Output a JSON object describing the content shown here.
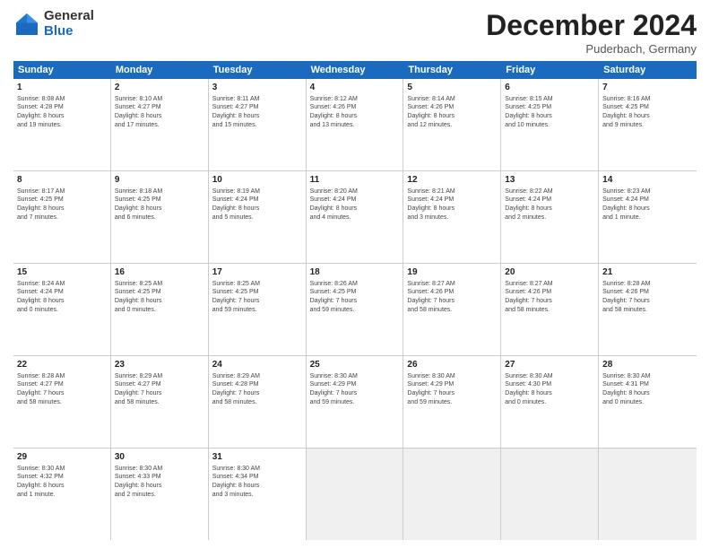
{
  "header": {
    "logo_general": "General",
    "logo_blue": "Blue",
    "month_title": "December 2024",
    "location": "Puderbach, Germany"
  },
  "calendar": {
    "days_of_week": [
      "Sunday",
      "Monday",
      "Tuesday",
      "Wednesday",
      "Thursday",
      "Friday",
      "Saturday"
    ],
    "weeks": [
      [
        {
          "day": "1",
          "info": "Sunrise: 8:08 AM\nSunset: 4:28 PM\nDaylight: 8 hours\nand 19 minutes."
        },
        {
          "day": "2",
          "info": "Sunrise: 8:10 AM\nSunset: 4:27 PM\nDaylight: 8 hours\nand 17 minutes."
        },
        {
          "day": "3",
          "info": "Sunrise: 8:11 AM\nSunset: 4:27 PM\nDaylight: 8 hours\nand 15 minutes."
        },
        {
          "day": "4",
          "info": "Sunrise: 8:12 AM\nSunset: 4:26 PM\nDaylight: 8 hours\nand 13 minutes."
        },
        {
          "day": "5",
          "info": "Sunrise: 8:14 AM\nSunset: 4:26 PM\nDaylight: 8 hours\nand 12 minutes."
        },
        {
          "day": "6",
          "info": "Sunrise: 8:15 AM\nSunset: 4:25 PM\nDaylight: 8 hours\nand 10 minutes."
        },
        {
          "day": "7",
          "info": "Sunrise: 8:16 AM\nSunset: 4:25 PM\nDaylight: 8 hours\nand 9 minutes."
        }
      ],
      [
        {
          "day": "8",
          "info": "Sunrise: 8:17 AM\nSunset: 4:25 PM\nDaylight: 8 hours\nand 7 minutes."
        },
        {
          "day": "9",
          "info": "Sunrise: 8:18 AM\nSunset: 4:25 PM\nDaylight: 8 hours\nand 6 minutes."
        },
        {
          "day": "10",
          "info": "Sunrise: 8:19 AM\nSunset: 4:24 PM\nDaylight: 8 hours\nand 5 minutes."
        },
        {
          "day": "11",
          "info": "Sunrise: 8:20 AM\nSunset: 4:24 PM\nDaylight: 8 hours\nand 4 minutes."
        },
        {
          "day": "12",
          "info": "Sunrise: 8:21 AM\nSunset: 4:24 PM\nDaylight: 8 hours\nand 3 minutes."
        },
        {
          "day": "13",
          "info": "Sunrise: 8:22 AM\nSunset: 4:24 PM\nDaylight: 8 hours\nand 2 minutes."
        },
        {
          "day": "14",
          "info": "Sunrise: 8:23 AM\nSunset: 4:24 PM\nDaylight: 8 hours\nand 1 minute."
        }
      ],
      [
        {
          "day": "15",
          "info": "Sunrise: 8:24 AM\nSunset: 4:24 PM\nDaylight: 8 hours\nand 0 minutes."
        },
        {
          "day": "16",
          "info": "Sunrise: 8:25 AM\nSunset: 4:25 PM\nDaylight: 8 hours\nand 0 minutes."
        },
        {
          "day": "17",
          "info": "Sunrise: 8:25 AM\nSunset: 4:25 PM\nDaylight: 7 hours\nand 59 minutes."
        },
        {
          "day": "18",
          "info": "Sunrise: 8:26 AM\nSunset: 4:25 PM\nDaylight: 7 hours\nand 59 minutes."
        },
        {
          "day": "19",
          "info": "Sunrise: 8:27 AM\nSunset: 4:26 PM\nDaylight: 7 hours\nand 58 minutes."
        },
        {
          "day": "20",
          "info": "Sunrise: 8:27 AM\nSunset: 4:26 PM\nDaylight: 7 hours\nand 58 minutes."
        },
        {
          "day": "21",
          "info": "Sunrise: 8:28 AM\nSunset: 4:26 PM\nDaylight: 7 hours\nand 58 minutes."
        }
      ],
      [
        {
          "day": "22",
          "info": "Sunrise: 8:28 AM\nSunset: 4:27 PM\nDaylight: 7 hours\nand 58 minutes."
        },
        {
          "day": "23",
          "info": "Sunrise: 8:29 AM\nSunset: 4:27 PM\nDaylight: 7 hours\nand 58 minutes."
        },
        {
          "day": "24",
          "info": "Sunrise: 8:29 AM\nSunset: 4:28 PM\nDaylight: 7 hours\nand 58 minutes."
        },
        {
          "day": "25",
          "info": "Sunrise: 8:30 AM\nSunset: 4:29 PM\nDaylight: 7 hours\nand 59 minutes."
        },
        {
          "day": "26",
          "info": "Sunrise: 8:30 AM\nSunset: 4:29 PM\nDaylight: 7 hours\nand 59 minutes."
        },
        {
          "day": "27",
          "info": "Sunrise: 8:30 AM\nSunset: 4:30 PM\nDaylight: 8 hours\nand 0 minutes."
        },
        {
          "day": "28",
          "info": "Sunrise: 8:30 AM\nSunset: 4:31 PM\nDaylight: 8 hours\nand 0 minutes."
        }
      ],
      [
        {
          "day": "29",
          "info": "Sunrise: 8:30 AM\nSunset: 4:32 PM\nDaylight: 8 hours\nand 1 minute."
        },
        {
          "day": "30",
          "info": "Sunrise: 8:30 AM\nSunset: 4:33 PM\nDaylight: 8 hours\nand 2 minutes."
        },
        {
          "day": "31",
          "info": "Sunrise: 8:30 AM\nSunset: 4:34 PM\nDaylight: 8 hours\nand 3 minutes."
        },
        {
          "day": "",
          "info": ""
        },
        {
          "day": "",
          "info": ""
        },
        {
          "day": "",
          "info": ""
        },
        {
          "day": "",
          "info": ""
        }
      ]
    ]
  }
}
